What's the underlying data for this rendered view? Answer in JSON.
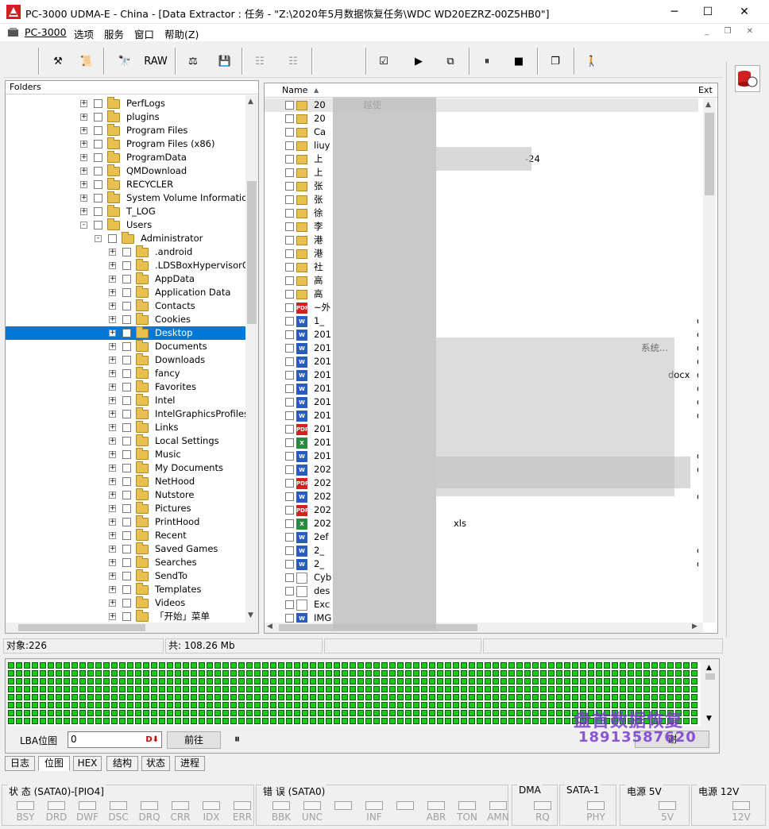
{
  "window": {
    "title": "PC-3000 UDMA-E - China - [Data Extractor : 任务 - \"Z:\\2020年5月数据恢复任务\\WDC WD20EZRZ-00Z5HB0\"]",
    "minimize": "─",
    "maximize": "☐",
    "close": "✕"
  },
  "menu": [
    "PC-3000",
    "选项",
    "服务",
    "窗口",
    "帮助(Z)"
  ],
  "toolbar": {
    "raw_label": "RAW"
  },
  "folders": {
    "header": "Folders",
    "items": [
      {
        "label": "PerfLogs"
      },
      {
        "label": "plugins"
      },
      {
        "label": "Program Files"
      },
      {
        "label": "Program Files (x86)"
      },
      {
        "label": "ProgramData"
      },
      {
        "label": "QMDownload"
      },
      {
        "label": "RECYCLER"
      },
      {
        "label": "System Volume Information"
      },
      {
        "label": "T_LOG"
      },
      {
        "label": "Users"
      },
      {
        "label": "Administrator"
      },
      {
        "label": ".android"
      },
      {
        "label": ".LDSBoxHypervisorGlob"
      },
      {
        "label": "AppData"
      },
      {
        "label": "Application Data"
      },
      {
        "label": "Contacts"
      },
      {
        "label": "Cookies"
      },
      {
        "label": "Desktop"
      },
      {
        "label": "Documents"
      },
      {
        "label": "Downloads"
      },
      {
        "label": "fancy"
      },
      {
        "label": "Favorites"
      },
      {
        "label": "Intel"
      },
      {
        "label": "IntelGraphicsProfiles"
      },
      {
        "label": "Links"
      },
      {
        "label": "Local Settings"
      },
      {
        "label": "Music"
      },
      {
        "label": "My Documents"
      },
      {
        "label": "NetHood"
      },
      {
        "label": "Nutstore"
      },
      {
        "label": "Pictures"
      },
      {
        "label": "PrintHood"
      },
      {
        "label": "Recent"
      },
      {
        "label": "Saved Games"
      },
      {
        "label": "Searches"
      },
      {
        "label": "SendTo"
      },
      {
        "label": "Templates"
      },
      {
        "label": "Videos"
      },
      {
        "label": "「开始」菜单"
      }
    ]
  },
  "files": {
    "col_name": "Name",
    "col_ext": "Ext",
    "rows": [
      {
        "icon": "folder",
        "name": "20",
        "tail": "越使",
        "ext": ""
      },
      {
        "icon": "folder",
        "name": "20",
        "tail": "",
        "ext": ""
      },
      {
        "icon": "folder",
        "name": "Ca",
        "tail": "",
        "ext": ""
      },
      {
        "icon": "folder",
        "name": "liuy",
        "tail": "",
        "ext": ""
      },
      {
        "icon": "folder",
        "name": "上",
        "tail": "-24",
        "ext": ""
      },
      {
        "icon": "folder",
        "name": "上",
        "tail": "",
        "ext": ""
      },
      {
        "icon": "folder",
        "name": "张",
        "tail": "",
        "ext": ""
      },
      {
        "icon": "folder",
        "name": "张",
        "tail": "",
        "ext": ""
      },
      {
        "icon": "folder",
        "name": "徐",
        "tail": "",
        "ext": ""
      },
      {
        "icon": "folder",
        "name": "李",
        "tail": "",
        "ext": ""
      },
      {
        "icon": "folder",
        "name": "港",
        "tail": "",
        "ext": ""
      },
      {
        "icon": "folder",
        "name": "港",
        "tail": "",
        "ext": ""
      },
      {
        "icon": "folder",
        "name": "社",
        "tail": "",
        "ext": ""
      },
      {
        "icon": "folder",
        "name": "高",
        "tail": "",
        "ext": ""
      },
      {
        "icon": "folder",
        "name": "高",
        "tail": "",
        "ext": ""
      },
      {
        "icon": "pdf",
        "name": "~外",
        "tail": "",
        "ext": ""
      },
      {
        "icon": "doc",
        "name": "1_",
        "tail": "",
        "ext": "d"
      },
      {
        "icon": "doc",
        "name": "201",
        "tail": "",
        "ext": "d"
      },
      {
        "icon": "doc",
        "name": "201",
        "tail": "系统...",
        "ext": "d"
      },
      {
        "icon": "doc",
        "name": "201",
        "tail": "",
        "ext": "d"
      },
      {
        "icon": "doc",
        "name": "201",
        "tail": "docx",
        "ext": "d"
      },
      {
        "icon": "doc",
        "name": "201",
        "tail": "",
        "ext": "d"
      },
      {
        "icon": "doc",
        "name": "201",
        "tail": "",
        "ext": "d"
      },
      {
        "icon": "doc",
        "name": "201",
        "tail": "",
        "ext": "d"
      },
      {
        "icon": "pdf",
        "name": "201",
        "tail": "",
        "ext": ""
      },
      {
        "icon": "xls",
        "name": "201",
        "tail": "",
        "ext": ""
      },
      {
        "icon": "doc",
        "name": "201",
        "tail": "",
        "ext": "d"
      },
      {
        "icon": "doc",
        "name": "202",
        "tail": "",
        "ext": "d"
      },
      {
        "icon": "pdf",
        "name": "202",
        "tail": "",
        "ext": ""
      },
      {
        "icon": "doc",
        "name": "202",
        "tail": "",
        "ext": "d"
      },
      {
        "icon": "pdf",
        "name": "202",
        "tail": "",
        "ext": ""
      },
      {
        "icon": "xls",
        "name": "202",
        "tail": "xls",
        "ext": ""
      },
      {
        "icon": "doc",
        "name": "2ef",
        "tail": "",
        "ext": ""
      },
      {
        "icon": "doc",
        "name": "2_",
        "tail": "",
        "ext": "d"
      },
      {
        "icon": "doc",
        "name": "2_",
        "tail": "",
        "ext": "d"
      },
      {
        "icon": "gen",
        "name": "Cyb",
        "tail": "",
        "ext": ""
      },
      {
        "icon": "gen",
        "name": "des",
        "tail": "",
        "ext": ""
      },
      {
        "icon": "gen",
        "name": "Exc",
        "tail": "",
        "ext": ""
      },
      {
        "icon": "doc",
        "name": "IMG",
        "tail": "",
        "ext": ""
      }
    ]
  },
  "status": {
    "objects": "对象:226",
    "total": "共:  108.26 Mb"
  },
  "lba": {
    "label": "LBA位图",
    "value": "0",
    "goto_button": "前往",
    "pause_icon": "⏸",
    "grid_color": "#19c819",
    "right_button_label": "谢"
  },
  "tabs": [
    "日志",
    "位图",
    "HEX",
    "结构",
    "状态",
    "进程"
  ],
  "active_tab": "位图",
  "indicators": {
    "status_group": {
      "title": "状 态 (SATA0)-[PIO4]",
      "leds": [
        "BSY",
        "DRD",
        "DWF",
        "DSC",
        "DRQ",
        "CRR",
        "IDX",
        "ERR"
      ]
    },
    "error_group": {
      "title": "错 误 (SATA0)",
      "leds": [
        "BBK",
        "UNC",
        "",
        "INF",
        "",
        "ABR",
        "TON",
        "AMN"
      ]
    },
    "dma_group": {
      "title": "DMA",
      "leds": [
        "RQ"
      ]
    },
    "sata_group": {
      "title": "SATA-1",
      "leds": [
        "PHY"
      ]
    },
    "power5_group": {
      "title": "电源 5V",
      "leds": [
        "5V"
      ]
    },
    "power12_group": {
      "title": "电源 12V",
      "leds": [
        "12V"
      ]
    }
  },
  "watermark": {
    "line1": "盘首数据恢复",
    "line2": "18913587620"
  }
}
